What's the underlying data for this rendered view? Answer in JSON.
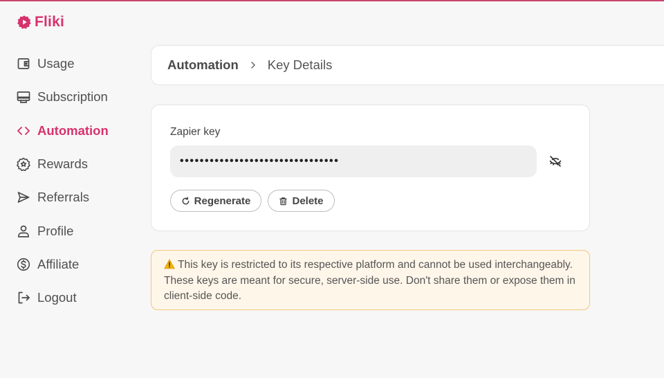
{
  "brand": {
    "name": "Fliki",
    "color": "#d6336c"
  },
  "sidebar": {
    "items": [
      {
        "label": "Usage",
        "icon": "wallet-icon",
        "active": false
      },
      {
        "label": "Subscription",
        "icon": "credit-card-icon",
        "active": false
      },
      {
        "label": "Automation",
        "icon": "code-icon",
        "active": true
      },
      {
        "label": "Rewards",
        "icon": "badge-star-icon",
        "active": false
      },
      {
        "label": "Referrals",
        "icon": "send-icon",
        "active": false
      },
      {
        "label": "Profile",
        "icon": "user-icon",
        "active": false
      },
      {
        "label": "Affiliate",
        "icon": "dollar-circle-icon",
        "active": false
      },
      {
        "label": "Logout",
        "icon": "logout-icon",
        "active": false
      }
    ]
  },
  "breadcrumb": {
    "root": "Automation",
    "current": "Key Details"
  },
  "key_card": {
    "label": "Zapier key",
    "masked_value": "••••••••••••••••••••••••••••••••",
    "regenerate_label": "Regenerate",
    "delete_label": "Delete",
    "visibility_icon": "eye-off-icon"
  },
  "warning": {
    "icon": "warning-icon",
    "text": "This key is restricted to its respective platform and cannot be used interchangeably. These keys are meant for secure, server-side use. Don't share them or expose them in client-side code."
  },
  "colors": {
    "accent": "#d6336c",
    "warning_bg": "#fff6ea",
    "warning_border": "#f3c67a"
  }
}
